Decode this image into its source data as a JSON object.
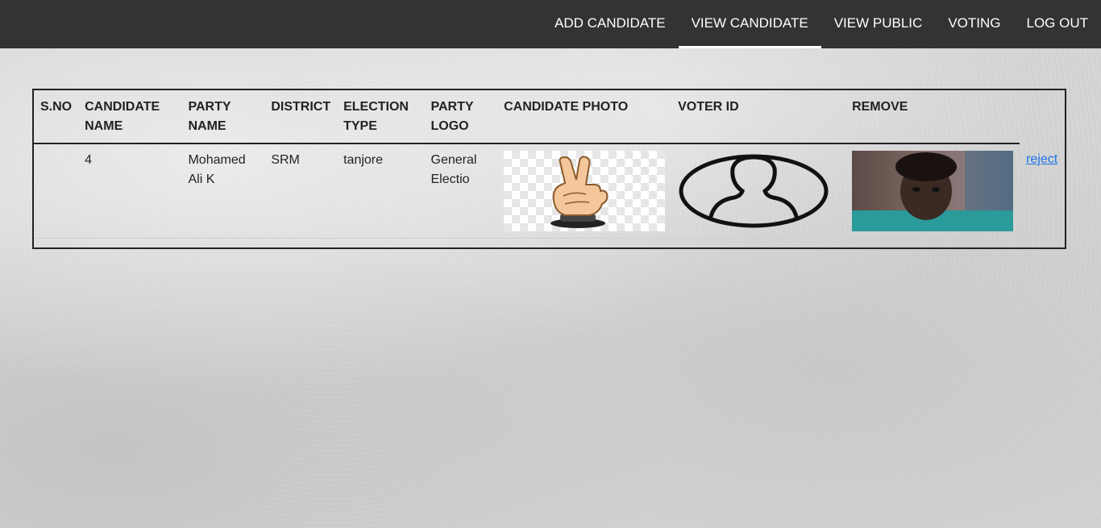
{
  "nav": {
    "items": [
      {
        "label": "ADD CANDIDATE",
        "active": false
      },
      {
        "label": "VIEW CANDIDATE",
        "active": true
      },
      {
        "label": "VIEW PUBLIC",
        "active": false
      },
      {
        "label": "VOTING",
        "active": false
      },
      {
        "label": "LOG OUT",
        "active": false
      }
    ]
  },
  "table": {
    "headers": {
      "sno": "S.NO",
      "candidate_name": "CANDIDATE NAME",
      "party_name": "PARTY NAME",
      "district": "DISTRICT",
      "election_type": "ELECTION TYPE",
      "party_logo": "PARTY LOGO",
      "candidate_photo": "CANDIDATE PHOTO",
      "voter_id": "VOTER ID",
      "remove": "REMOVE"
    },
    "rows": [
      {
        "sno": "",
        "candidate_name": "4",
        "party_name": "Mohamed Ali K",
        "district": "SRM",
        "election_type": "tanjore",
        "party_logo": "General Electio",
        "candidate_photo_icon": "victory-hand-logo-icon",
        "voter_id_icon": "person-silhouette-icon",
        "remove_icon": "candidate-face-photo",
        "action_label": "reject"
      }
    ]
  },
  "colors": {
    "navbar": "#333333",
    "link": "#1a73e8",
    "border": "#222222"
  }
}
